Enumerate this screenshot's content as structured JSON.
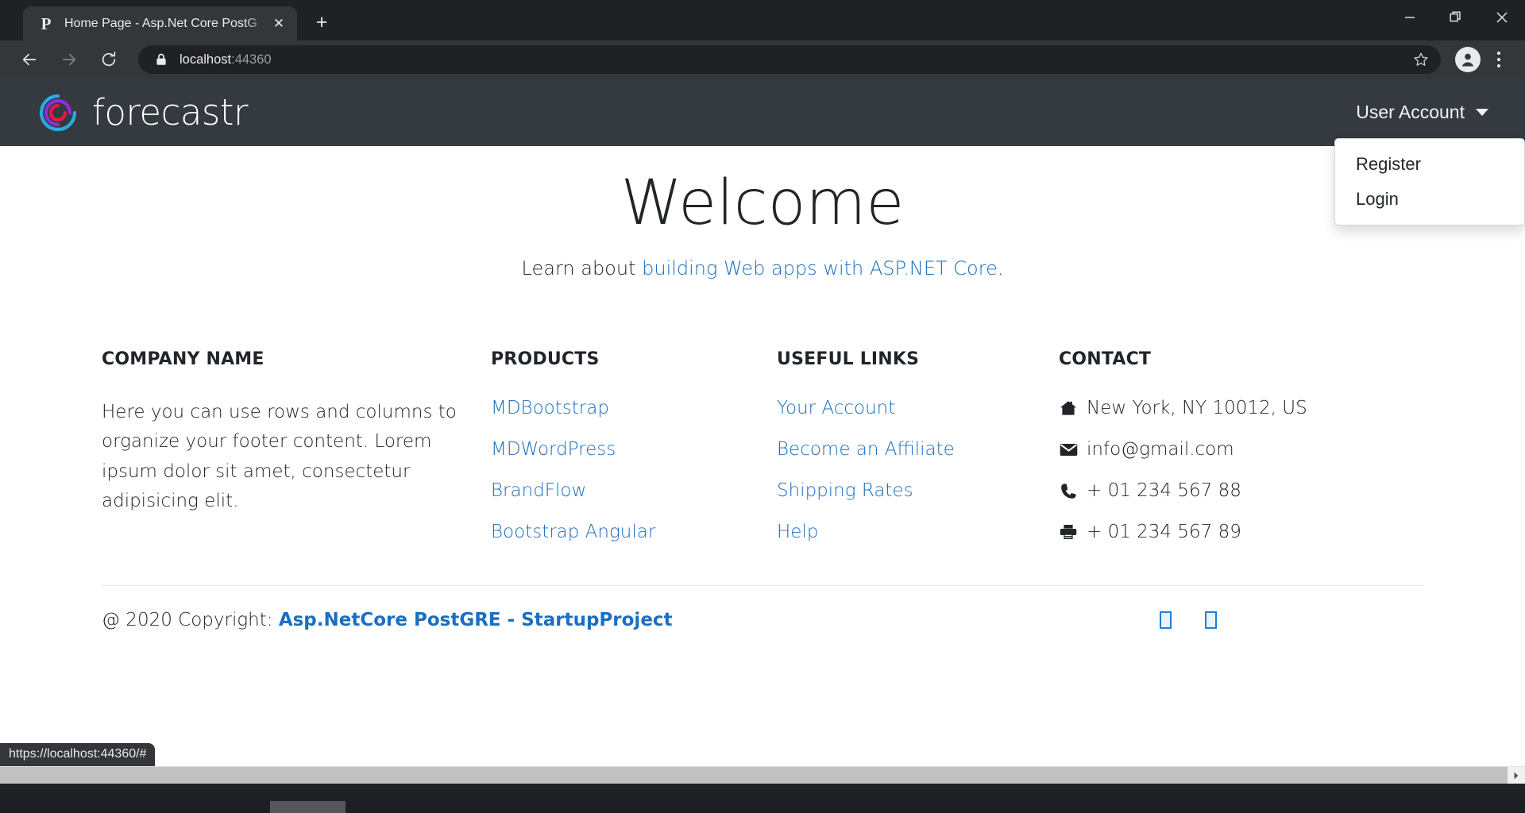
{
  "browser": {
    "tab": {
      "favicon_letter": "P",
      "title": "Home Page - Asp.Net Core PostG",
      "close_label": "✕"
    },
    "new_tab_label": "+",
    "omnibox": {
      "url_host": "localhost",
      "url_rest": ":44360",
      "full_url": "localhost:44360"
    },
    "status_url": "https://localhost:44360/#",
    "icons": {
      "back": "back-arrow-icon",
      "forward": "forward-arrow-icon",
      "reload": "reload-icon",
      "lock": "lock-icon",
      "star": "star-bookmark-icon",
      "profile": "profile-avatar-icon",
      "menu": "kebab-menu-icon",
      "minimize": "minimize-icon",
      "restore": "restore-window-icon",
      "close": "close-window-icon"
    }
  },
  "site": {
    "brand": {
      "name": "forecastr",
      "logo_colors": {
        "outer": "#29ABE2",
        "middle": "#8E2DE2",
        "inner": "#E8174B"
      }
    },
    "account_menu": {
      "label": "User Account",
      "items": [
        {
          "label": "Register"
        },
        {
          "label": "Login"
        }
      ]
    }
  },
  "hero": {
    "title": "Welcome",
    "subtitle_prefix": "Learn about ",
    "subtitle_link": "building Web apps with ASP.NET Core",
    "subtitle_suffix": "."
  },
  "footer": {
    "columns": [
      {
        "heading": "Company name",
        "body": "Here you can use rows and columns to organize your footer content. Lorem ipsum dolor sit amet, consectetur adipisicing elit."
      },
      {
        "heading": "Products",
        "links": [
          "MDBootstrap",
          "MDWordPress",
          "BrandFlow",
          "Bootstrap Angular"
        ]
      },
      {
        "heading": "Useful links",
        "links": [
          "Your Account",
          "Become an Affiliate",
          "Shipping Rates",
          "Help"
        ]
      },
      {
        "heading": "Contact",
        "items": [
          {
            "icon": "home-icon",
            "text": "New York, NY 10012, US"
          },
          {
            "icon": "envelope-icon",
            "text": "info@gmail.com"
          },
          {
            "icon": "phone-icon",
            "text": "+ 01 234 567 88"
          },
          {
            "icon": "printer-icon",
            "text": "+ 01 234 567 89"
          }
        ]
      }
    ],
    "copyright_prefix": "@ 2020 Copyright: ",
    "copyright_link": "Asp.NetCore PostGRE - StartupProject",
    "social": [
      {
        "name": "social-icon-1",
        "glyph": " "
      },
      {
        "name": "social-icon-2",
        "glyph": " "
      }
    ]
  },
  "colors": {
    "navbar_bg": "#343a40",
    "link_blue": "#1b6ec2",
    "browser_dark": "#202124",
    "toolbar_dark": "#35363a"
  }
}
